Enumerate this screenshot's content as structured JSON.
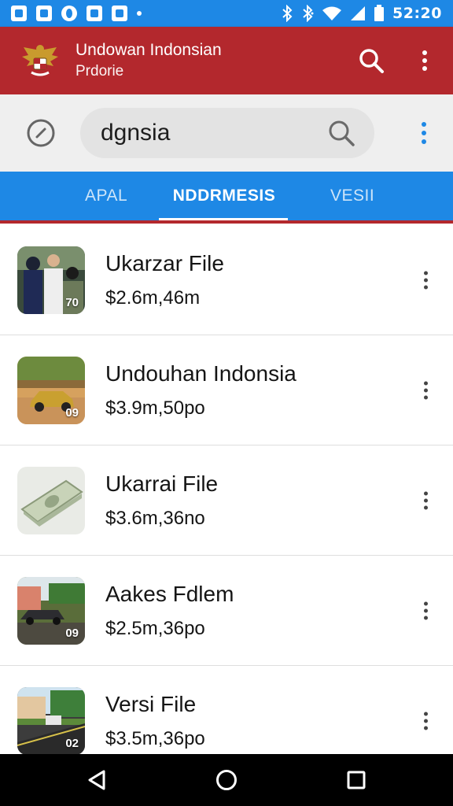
{
  "status_bar": {
    "time": "52:20",
    "left_icons": [
      "image-icon",
      "gallery-icon",
      "alarm-icon",
      "app-icon",
      "edit-icon",
      "dot-icon"
    ],
    "right_icons": [
      "bluetooth-icon",
      "vibrate-icon",
      "wifi-icon",
      "signal-icon",
      "battery-icon"
    ]
  },
  "app_bar": {
    "title": "Undowan Indonsian",
    "subtitle": "Prdorie",
    "logo": "garuda-emblem",
    "color": "#b3282d"
  },
  "search": {
    "value": "dgnsia",
    "placeholder": ""
  },
  "tabs": [
    {
      "label": "APAL",
      "active": false
    },
    {
      "label": "NDDRMESIS",
      "active": true
    },
    {
      "label": "VESII",
      "active": false
    }
  ],
  "accent_color": "#1e88e5",
  "items": [
    {
      "name": "Ukarzar File",
      "price": "$2.6m,46m",
      "badge": "70",
      "thumb": "people-photo"
    },
    {
      "name": "Undouhan Indonsia",
      "price": "$3.9m,50po",
      "badge": "09",
      "thumb": "car-photo"
    },
    {
      "name": "Ukarrai File",
      "price": "$3.6m,36no",
      "badge": "",
      "thumb": "money-photo"
    },
    {
      "name": "Aakes Fdlem",
      "price": "$2.5m,36po",
      "badge": "09",
      "thumb": "street-photo"
    },
    {
      "name": "Versi File",
      "price": "$3.5m,36po",
      "badge": "02",
      "thumb": "road-photo"
    }
  ],
  "nav_bar": [
    "back-icon",
    "home-icon",
    "recents-icon"
  ]
}
